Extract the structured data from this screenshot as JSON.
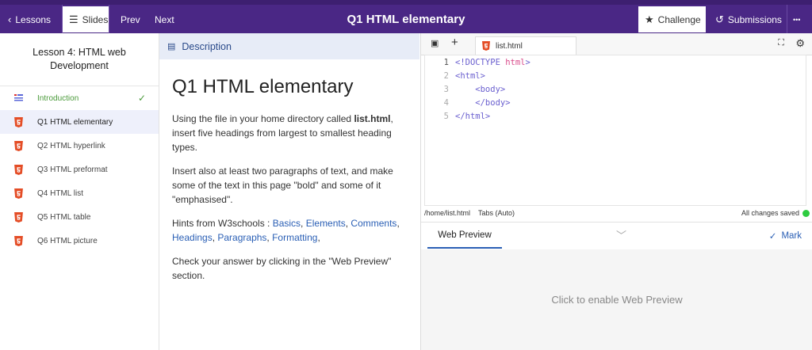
{
  "topbar": {
    "lessons_label": "Lessons",
    "slides_label": "Slides",
    "prev_label": "Prev",
    "next_label": "Next",
    "title": "Q1 HTML elementary",
    "challenge_label": "Challenge",
    "submissions_label": "Submissions",
    "more_label": "•••"
  },
  "sidebar": {
    "lesson_title": "Lesson 4: HTML web Development",
    "items": [
      {
        "label": "Introduction",
        "icon": "slides-icon",
        "state": "done"
      },
      {
        "label": "Q1 HTML elementary",
        "icon": "html5-icon",
        "state": "active"
      },
      {
        "label": "Q2 HTML hyperlink",
        "icon": "html5-icon",
        "state": ""
      },
      {
        "label": "Q3 HTML preformat",
        "icon": "html5-icon",
        "state": ""
      },
      {
        "label": "Q4 HTML list",
        "icon": "html5-icon",
        "state": ""
      },
      {
        "label": "Q5 HTML table",
        "icon": "html5-icon",
        "state": ""
      },
      {
        "label": "Q6 HTML picture",
        "icon": "html5-icon",
        "state": ""
      }
    ]
  },
  "description": {
    "header": "Description",
    "heading": "Q1 HTML elementary",
    "p1_a": "Using the file in your home directory called ",
    "p1_bold": "list.html",
    "p1_b": ", insert five headings from largest to smallest heading types.",
    "p2": "Insert also at least two paragraphs of text, and make some of the text in this page \"bold\" and some of it \"emphasised\".",
    "p3_prefix": "Hints from W3schools : ",
    "links": [
      "Basics",
      "Elements",
      "Comments",
      "Headings",
      "Paragraphs",
      "Formatting"
    ],
    "p4": "Check your answer by clicking in the \"Web Preview\" section."
  },
  "editor": {
    "tab_name": "list.html",
    "path": "/home/list.html",
    "indent_mode": "Tabs (Auto)",
    "save_status": "All changes saved",
    "code_lines": [
      {
        "n": "1",
        "pre": "<!DOCTYPE ",
        "kw": "html",
        "post": ">"
      },
      {
        "n": "2",
        "pre": "<html>",
        "kw": "",
        "post": ""
      },
      {
        "n": "3",
        "pre": "    <body>",
        "kw": "",
        "post": ""
      },
      {
        "n": "4",
        "pre": "    </body>",
        "kw": "",
        "post": ""
      },
      {
        "n": "5",
        "pre": "</html>",
        "kw": "",
        "post": ""
      }
    ],
    "web_preview_tab": "Web Preview",
    "mark_label": "Mark",
    "preview_placeholder": "Click to enable Web Preview"
  }
}
